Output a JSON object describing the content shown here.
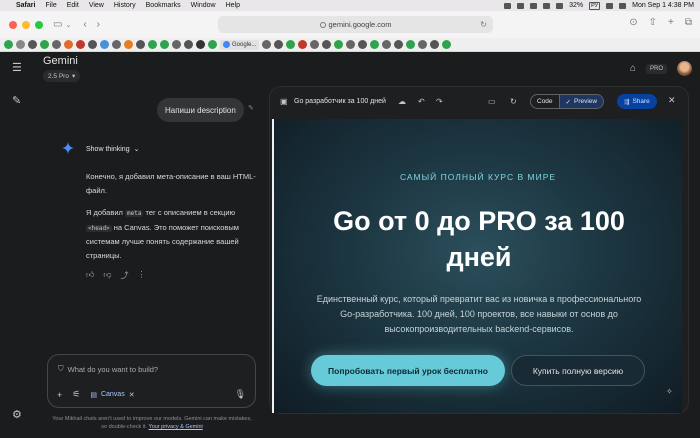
{
  "menubar": {
    "apple": "",
    "app": "Safari",
    "items": [
      "File",
      "Edit",
      "View",
      "History",
      "Bookmarks",
      "Window",
      "Help"
    ],
    "battery": "32%",
    "input_lang": "РУ",
    "clock": "Mon Sep 1  4:38 PM"
  },
  "browser": {
    "url": "gemini.google.com",
    "favorite_tab": "Google..."
  },
  "gemini": {
    "brand": "Gemini",
    "model": "2.5 Pro",
    "pro_badge": "PRO",
    "user_prompt": "Напиши description",
    "show_thinking": "Show thinking",
    "response": {
      "p1": "Конечно, я добавил мета-описание в ваш HTML-файл.",
      "p2_a": "Я добавил ",
      "p2_code1": "meta",
      "p2_b": " тег с описанием в секцию ",
      "p2_code2": "<head>",
      "p2_c": " на Canvas. Это поможет поисковым системам лучше понять содержание вашей страницы."
    },
    "input": {
      "placeholder": "What do you want to build?",
      "canvas_chip": "Canvas"
    },
    "disclaimer": "Your Mikhail chats aren't used to improve our models. Gemini can make mistakes, so double-check it.",
    "disclaimer_link": "Your privacy & Gemini"
  },
  "canvas": {
    "title": "Go разработчик за 100 дней",
    "code_label": "Code",
    "preview_label": "Preview",
    "share_label": "Share",
    "page": {
      "kicker": "САМЫЙ ПОЛНЫЙ КУРС В МИРЕ",
      "headline_line1": "Go от 0 до PRO за 100",
      "headline_line2": "дней",
      "sub_line1": "Единственный курс, который превратит вас из новичка в профессионального",
      "sub_line2": "Go-разработчика. 100 дней, 100 проектов, все навыки от основ до",
      "sub_line3": "высокопроизводительных backend-сервисов.",
      "cta_primary": "Попробовать первый урок бесплатно",
      "cta_secondary": "Купить полную версию"
    }
  },
  "colors": {
    "accent_cyan": "#67cad8",
    "share_blue": "#0842a0",
    "bg_dark": "#1b1c1d"
  }
}
